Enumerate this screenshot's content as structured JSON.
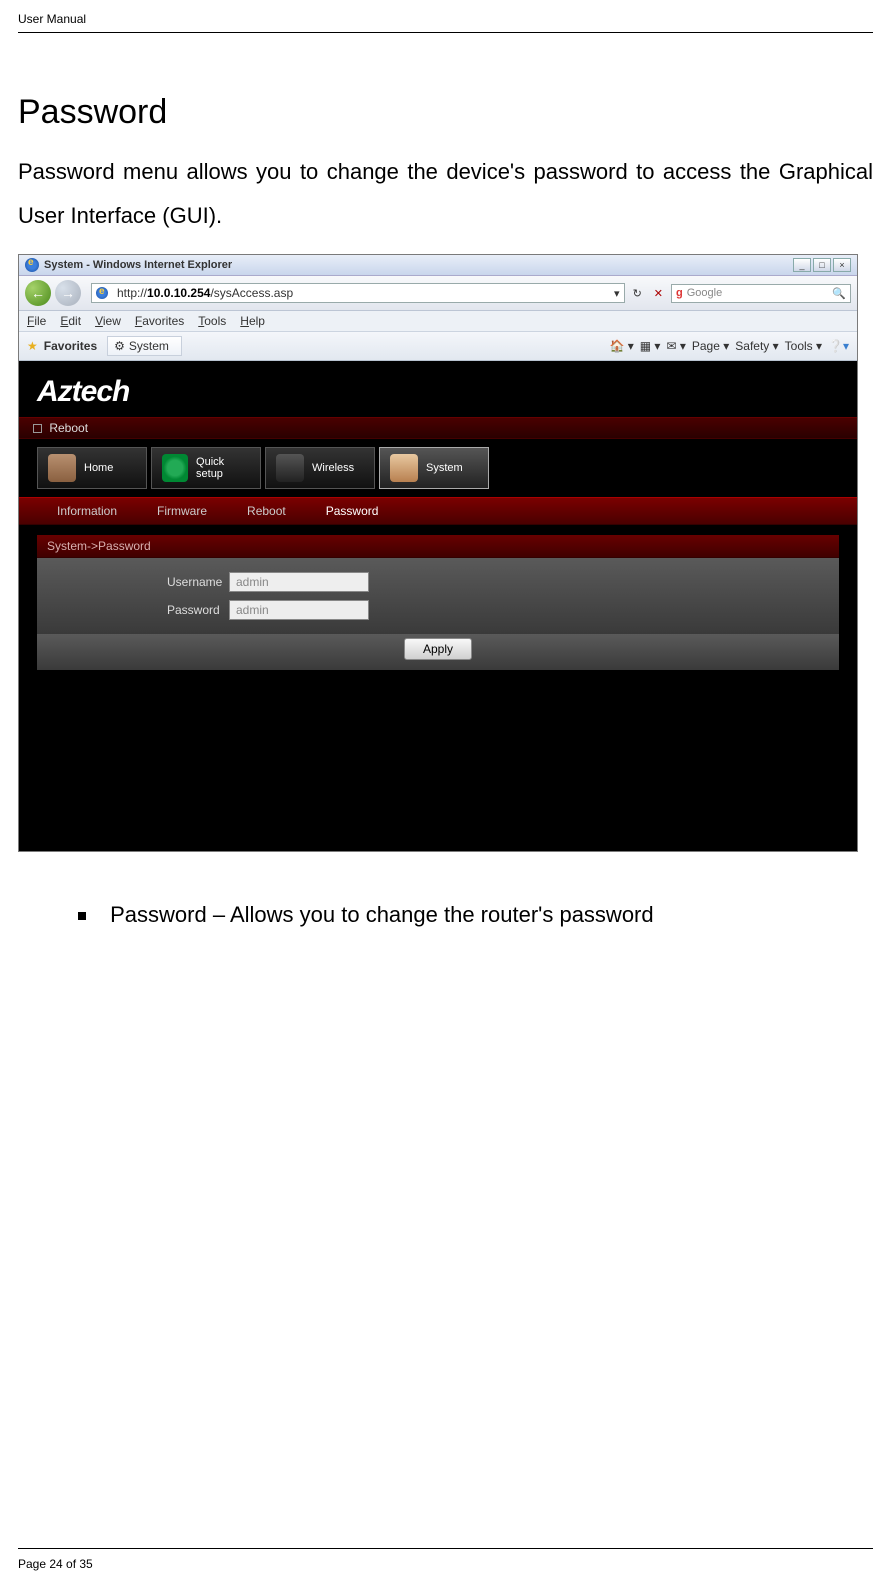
{
  "document": {
    "header": "User Manual",
    "pageLabel": "Page 24 of 35",
    "sectionTitle": "Password",
    "sectionBody": "Password menu allows you to change the device's password to access the Graphical User Interface (GUI).",
    "bulletText": "Password – Allows you to change the router's password"
  },
  "browser": {
    "windowTitle": "System - Windows Internet Explorer",
    "urlPrefix": "http://",
    "urlHost": "10.0.10.254",
    "urlPath": "/sysAccess.asp",
    "searchPlaceholder": "Google",
    "menus": [
      "File",
      "Edit",
      "View",
      "Favorites",
      "Tools",
      "Help"
    ],
    "favoritesLabel": "Favorites",
    "tabTitle": "System",
    "toolbarItems": [
      "Page",
      "Safety",
      "Tools"
    ],
    "winButtons": [
      "_",
      "□",
      "×"
    ]
  },
  "router": {
    "brand": "Aztech",
    "rebootLabel": "Reboot",
    "mainTabs": [
      "Home",
      "Quick setup",
      "Wireless",
      "System"
    ],
    "subTabs": [
      "Information",
      "Firmware",
      "Reboot",
      "Password"
    ],
    "panelTitle": "System->Password",
    "usernameLabel": "Username",
    "passwordLabel": "Password",
    "usernameValue": "admin",
    "passwordValue": "admin",
    "applyLabel": "Apply"
  }
}
